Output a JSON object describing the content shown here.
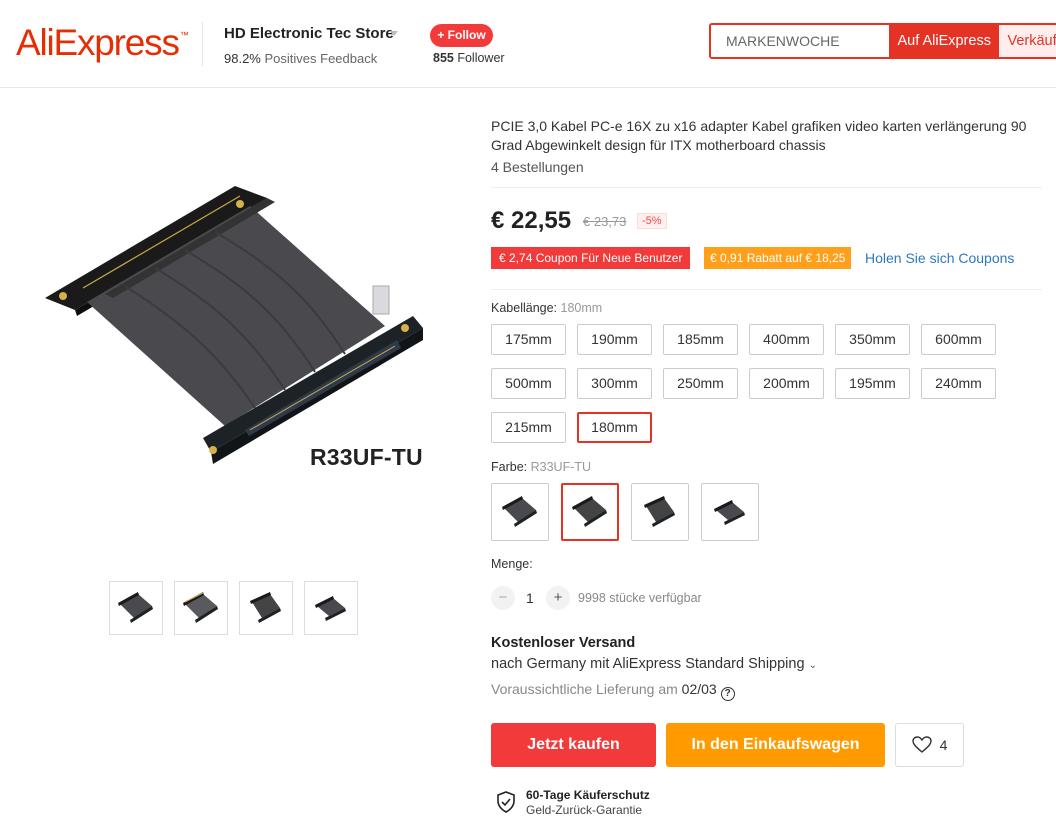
{
  "brand": {
    "logo_text": "AliExpress",
    "tm": "™",
    "accent": "#e62e04"
  },
  "store": {
    "name": "HD Electronic Tec Store",
    "feedback_pct": "98.2%",
    "feedback_label": "Positives Feedback",
    "follow_label": "+ Follow",
    "followers_count": "855",
    "followers_label": "Follower"
  },
  "search": {
    "value": "MARKENWOCHE",
    "button_aliexpress": "Auf AliExpress",
    "button_store": "Verkäufer"
  },
  "product": {
    "model_label": "R33UF-TU",
    "title": "PCIE 3,0 Kabel PC-e 16X zu x16 adapter Kabel grafiken video karten verlängerung 90 Grad Abgewinkelt design für ITX motherboard chassis",
    "orders": "4 Bestellungen",
    "price": "€ 22,55",
    "old_price": "€ 23,73",
    "discount": "-5%",
    "coupons": {
      "new_user": "€ 2,74 Coupon Für Neue Benutzer",
      "rebate": "€ 0,91 Rabatt auf € 18,25",
      "get_link": "Holen Sie sich Coupons"
    },
    "cable_length": {
      "label": "Kabellänge:",
      "selected": "180mm",
      "options": [
        "175mm",
        "190mm",
        "185mm",
        "400mm",
        "350mm",
        "600mm",
        "500mm",
        "300mm",
        "250mm",
        "200mm",
        "195mm",
        "240mm",
        "215mm",
        "180mm"
      ]
    },
    "color": {
      "label": "Farbe:",
      "selected": "R33UF-TU",
      "swatch_icons": [
        "riser-cable-variant-1",
        "riser-cable-variant-2",
        "riser-cable-variant-3",
        "riser-cable-variant-4"
      ]
    },
    "quantity": {
      "label": "Menge:",
      "value": "1",
      "available": "9998 stücke verfügbar"
    }
  },
  "shipping": {
    "title": "Kostenloser Versand",
    "line": "nach Germany mit AliExpress Standard Shipping",
    "delivery_label": "Voraussichtliche Lieferung am",
    "delivery_date": "02/03"
  },
  "actions": {
    "buy_now": "Jetzt kaufen",
    "add_to_cart": "In den Einkaufswagen",
    "wishlist_count": "4"
  },
  "protection": {
    "title": "60-Tage Käuferschutz",
    "subtitle": "Geld-Zurück-Garantie"
  },
  "colors": {
    "red": "#f33a3a",
    "orange": "#ff9b00",
    "link": "#2d78c3"
  }
}
